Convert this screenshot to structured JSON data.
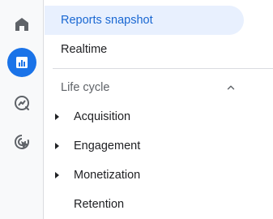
{
  "rail": {
    "items": [
      {
        "icon": "home-icon",
        "active": false
      },
      {
        "icon": "reports-icon",
        "active": true
      },
      {
        "icon": "explore-icon",
        "active": false
      },
      {
        "icon": "advertising-icon",
        "active": false
      }
    ],
    "accent_color": "#1a73e8"
  },
  "nav": {
    "top_items": [
      {
        "label": "Reports snapshot",
        "selected": true
      },
      {
        "label": "Realtime",
        "selected": false
      }
    ],
    "section": {
      "label": "Life cycle",
      "expanded": true
    },
    "section_items": [
      {
        "label": "Acquisition",
        "expandable": true
      },
      {
        "label": "Engagement",
        "expandable": true
      },
      {
        "label": "Monetization",
        "expandable": true
      },
      {
        "label": "Retention",
        "expandable": false
      }
    ],
    "selected_color": "#1967d2",
    "selected_bg": "#e8f0fe"
  }
}
